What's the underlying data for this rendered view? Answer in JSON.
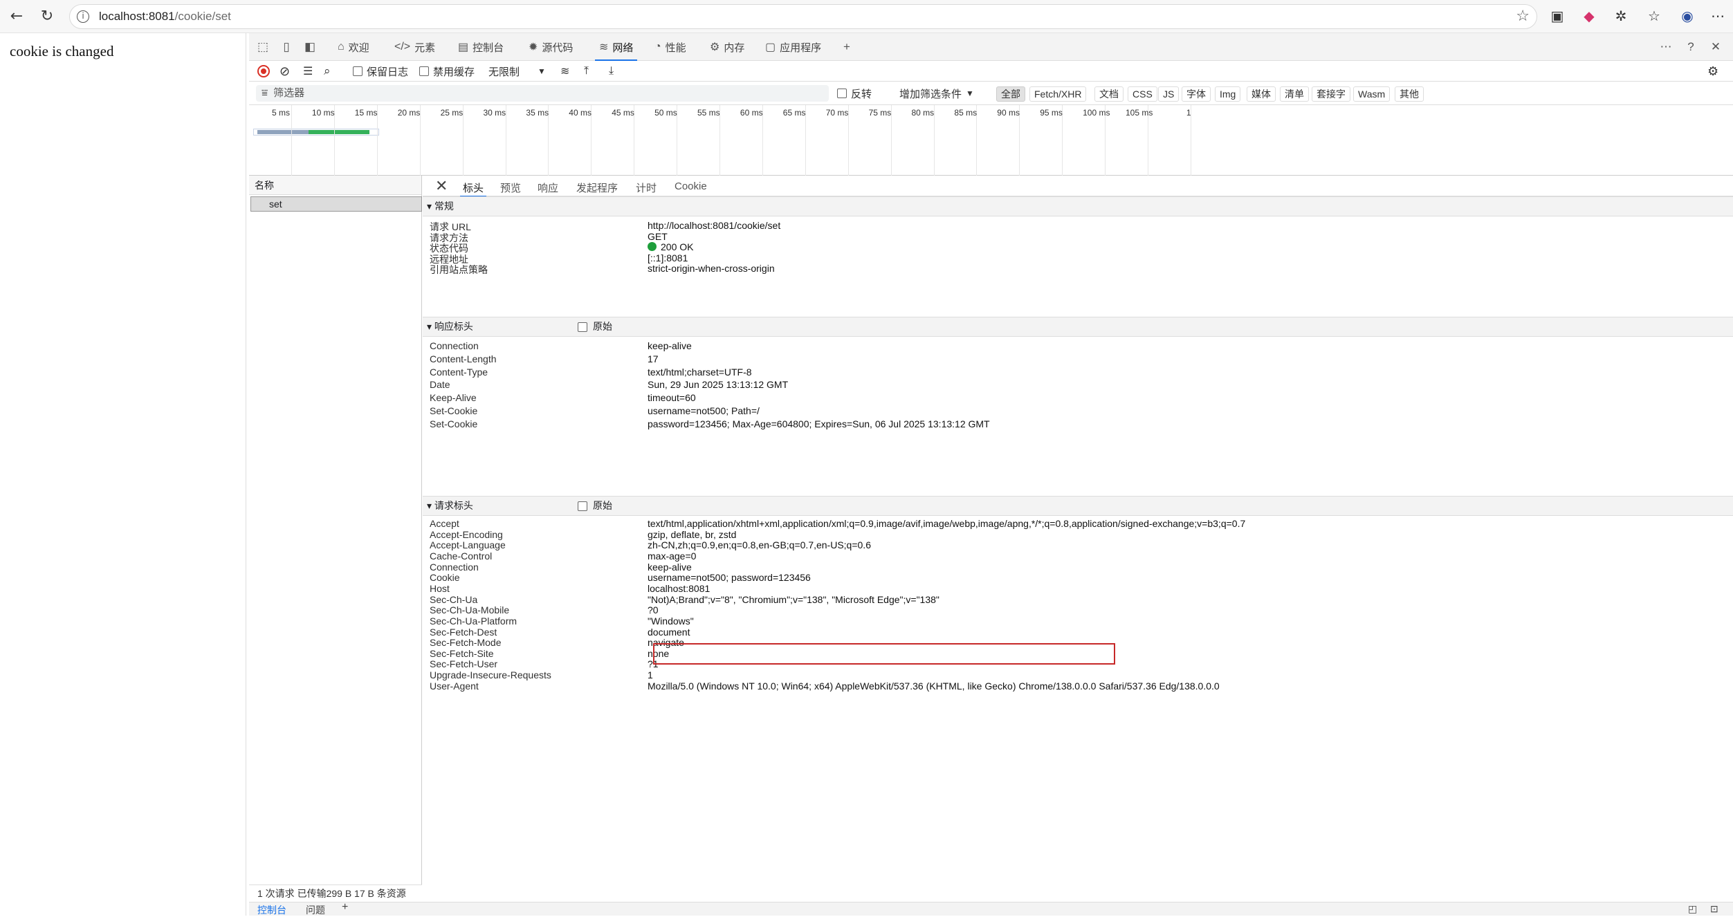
{
  "browser": {
    "url_host": "localhost:8081",
    "url_path": "/cookie/set",
    "icons": [
      "back-icon",
      "refresh-icon",
      "info-icon",
      "star-icon",
      "extension-icon",
      "favorites-icon",
      "profile-icon",
      "more-icon"
    ]
  },
  "page": {
    "message": "cookie is changed"
  },
  "devtools": {
    "tabs": [
      "欢迎",
      "元素",
      "控制台",
      "源代码",
      "网络",
      "性能",
      "内存",
      "应用程序"
    ],
    "active_tab": "网络",
    "toolbar": {
      "preserve_log": "保留日志",
      "disable_cache": "禁用缓存",
      "throttle": "无限制"
    },
    "filter": {
      "placeholder": "筛选器",
      "invert": "反转",
      "more_filters": "增加筛选条件",
      "types": [
        "全部",
        "Fetch/XHR",
        "文档",
        "CSS",
        "JS",
        "字体",
        "Img",
        "媒体",
        "清单",
        "套接字",
        "Wasm",
        "其他"
      ]
    },
    "timeline_ticks": [
      "5 ms",
      "10 ms",
      "15 ms",
      "20 ms",
      "25 ms",
      "30 ms",
      "35 ms",
      "40 ms",
      "45 ms",
      "50 ms",
      "55 ms",
      "60 ms",
      "65 ms",
      "70 ms",
      "75 ms",
      "80 ms",
      "85 ms",
      "90 ms",
      "95 ms",
      "100 ms",
      "105 ms",
      "1"
    ],
    "name_header": "名称",
    "request_name": "set",
    "detail_tabs": [
      "标头",
      "预览",
      "响应",
      "发起程序",
      "计时",
      "Cookie"
    ],
    "general": {
      "title": "常规",
      "rows": [
        {
          "k": "请求 URL",
          "v": "http://localhost:8081/cookie/set"
        },
        {
          "k": "请求方法",
          "v": "GET"
        },
        {
          "k": "状态代码",
          "v": "200 OK"
        },
        {
          "k": "远程地址",
          "v": "[::1]:8081"
        },
        {
          "k": "引用站点策略",
          "v": "strict-origin-when-cross-origin"
        }
      ]
    },
    "response_headers": {
      "title": "响应标头",
      "raw": "原始",
      "rows": [
        {
          "k": "Connection",
          "v": "keep-alive"
        },
        {
          "k": "Content-Length",
          "v": "17"
        },
        {
          "k": "Content-Type",
          "v": "text/html;charset=UTF-8"
        },
        {
          "k": "Date",
          "v": "Sun, 29 Jun 2025 13:13:12 GMT"
        },
        {
          "k": "Keep-Alive",
          "v": "timeout=60"
        },
        {
          "k": "Set-Cookie",
          "v": "username=not500; Path=/"
        },
        {
          "k": "Set-Cookie",
          "v": "password=123456; Max-Age=604800; Expires=Sun, 06 Jul 2025 13:13:12 GMT"
        }
      ]
    },
    "request_headers": {
      "title": "请求标头",
      "raw": "原始",
      "rows": [
        {
          "k": "Accept",
          "v": "text/html,application/xhtml+xml,application/xml;q=0.9,image/avif,image/webp,image/apng,*/*;q=0.8,application/signed-exchange;v=b3;q=0.7"
        },
        {
          "k": "Accept-Encoding",
          "v": "gzip, deflate, br, zstd"
        },
        {
          "k": "Accept-Language",
          "v": "zh-CN,zh;q=0.9,en;q=0.8,en-GB;q=0.7,en-US;q=0.6"
        },
        {
          "k": "Cache-Control",
          "v": "max-age=0"
        },
        {
          "k": "Connection",
          "v": "keep-alive"
        },
        {
          "k": "Cookie",
          "v": "username=not500; password=123456"
        },
        {
          "k": "Host",
          "v": "localhost:8081"
        },
        {
          "k": "Sec-Ch-Ua",
          "v": "\"Not)A;Brand\";v=\"8\", \"Chromium\";v=\"138\", \"Microsoft Edge\";v=\"138\""
        },
        {
          "k": "Sec-Ch-Ua-Mobile",
          "v": "?0"
        },
        {
          "k": "Sec-Ch-Ua-Platform",
          "v": "\"Windows\""
        },
        {
          "k": "Sec-Fetch-Dest",
          "v": "document"
        },
        {
          "k": "Sec-Fetch-Mode",
          "v": "navigate"
        },
        {
          "k": "Sec-Fetch-Site",
          "v": "none"
        },
        {
          "k": "Sec-Fetch-User",
          "v": "?1"
        },
        {
          "k": "Upgrade-Insecure-Requests",
          "v": "1"
        },
        {
          "k": "User-Agent",
          "v": "Mozilla/5.0 (Windows NT 10.0; Win64; x64) AppleWebKit/537.36 (KHTML, like Gecko) Chrome/138.0.0.0 Safari/537.36 Edg/138.0.0.0"
        }
      ]
    },
    "status_bar": "1 次请求   已传输299 B   17 B 条资源",
    "drawer_tabs": [
      "控制台",
      "问题"
    ],
    "status_ok_color": "#1e9e3b",
    "highlight_color": "#c62828"
  }
}
